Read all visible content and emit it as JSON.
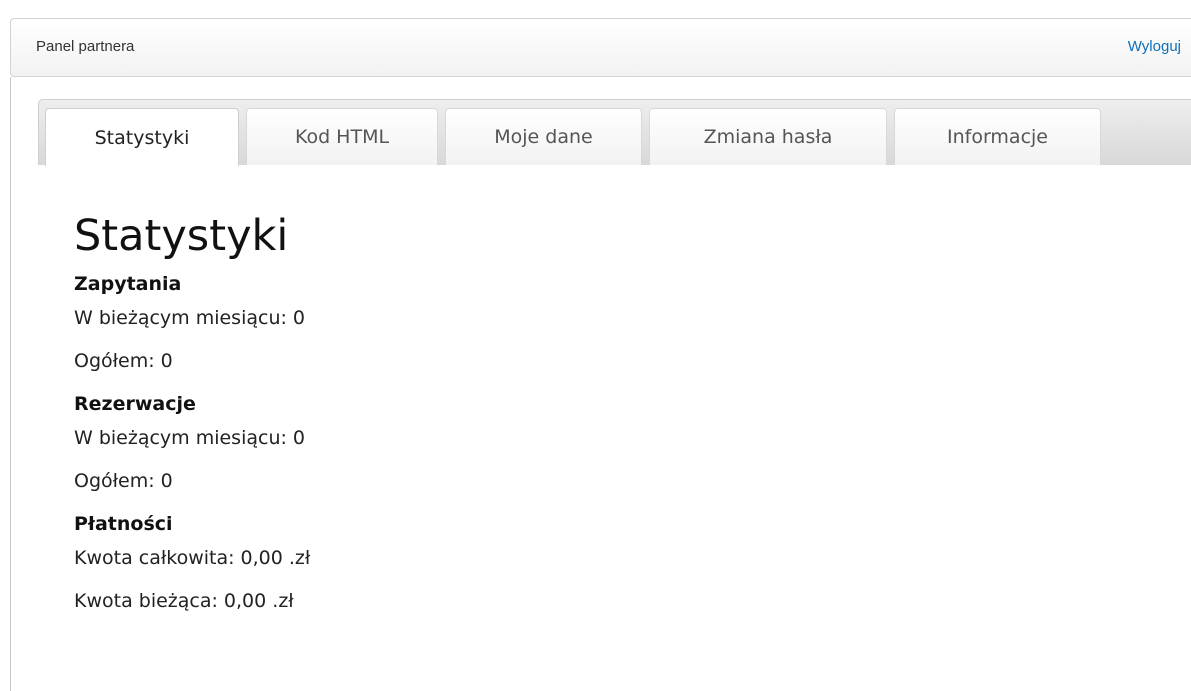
{
  "navbar": {
    "brand": "Panel partnera",
    "logout": "Wyloguj"
  },
  "tabs": [
    {
      "label": "Statystyki",
      "active": true
    },
    {
      "label": "Kod HTML",
      "active": false
    },
    {
      "label": "Moje dane",
      "active": false
    },
    {
      "label": "Zmiana hasła",
      "active": false
    },
    {
      "label": "Informacje",
      "active": false
    }
  ],
  "page": {
    "title": "Statystyki",
    "sections": [
      {
        "title": "Zapytania",
        "lines": [
          "W bieżącym miesiącu: 0",
          "Ogółem: 0"
        ]
      },
      {
        "title": "Rezerwacje",
        "lines": [
          "W bieżącym miesiącu: 0",
          "Ogółem: 0"
        ]
      },
      {
        "title": "Płatności",
        "lines": [
          "Kwota całkowita: 0,00 .zł",
          "Kwota bieżąca: 0,00 .zł"
        ]
      }
    ]
  }
}
